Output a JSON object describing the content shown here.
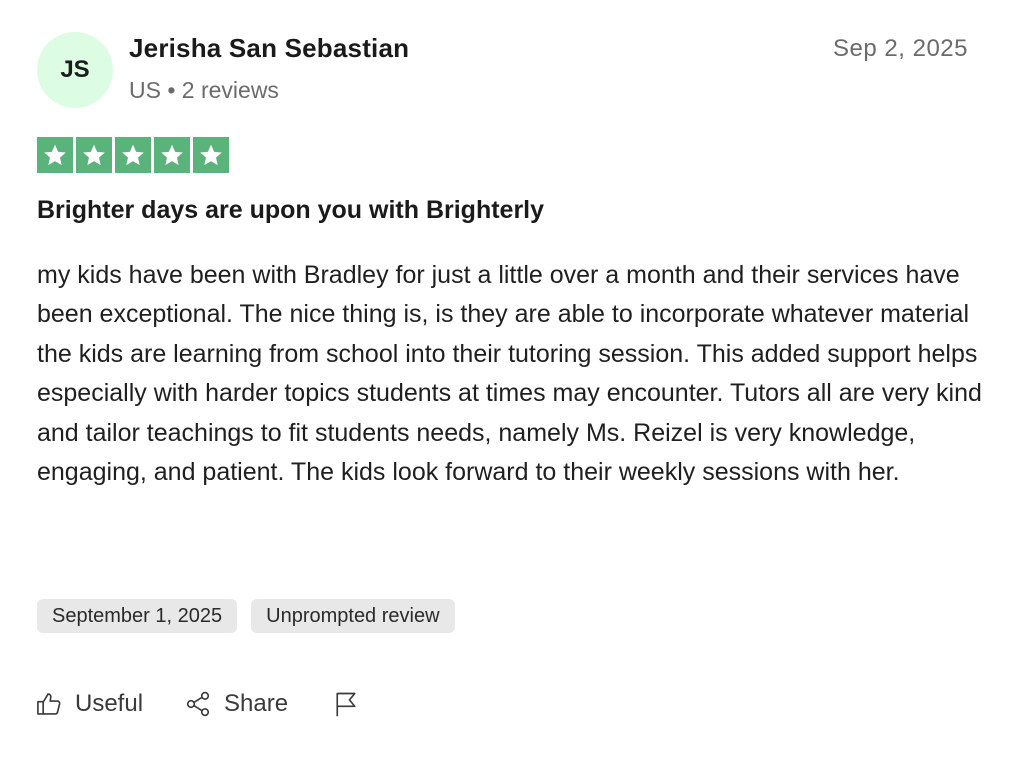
{
  "reviewer": {
    "initials": "JS",
    "name": "Jerisha San Sebastian",
    "meta": "US • 2 reviews"
  },
  "review": {
    "date": "Sep 2, 2025",
    "rating": 5,
    "rating_color": "#5bb37c",
    "title": "Brighter days are upon you with Brighterly",
    "body": "my kids have been with Bradley for just a little over a month and their services have been exceptional. The nice thing is, is they are able to incorporate whatever material the kids are learning from school into their tutoring session. This added support helps especially with harder topics students at times may encounter. Tutors all are very kind and tailor teachings to fit students needs, namely Ms. Reizel is very knowledge, engaging, and patient. The kids look forward to their weekly sessions with her.",
    "experience_date": "September 1, 2025",
    "review_type": "Unprompted review"
  },
  "actions": {
    "useful_label": "Useful",
    "share_label": "Share",
    "useful_icon": "thumbs-up-icon",
    "share_icon": "share-icon",
    "report_icon": "flag-icon"
  },
  "colors": {
    "avatar_bg": "#dcfce3",
    "chip_bg": "#e8e8e8"
  }
}
